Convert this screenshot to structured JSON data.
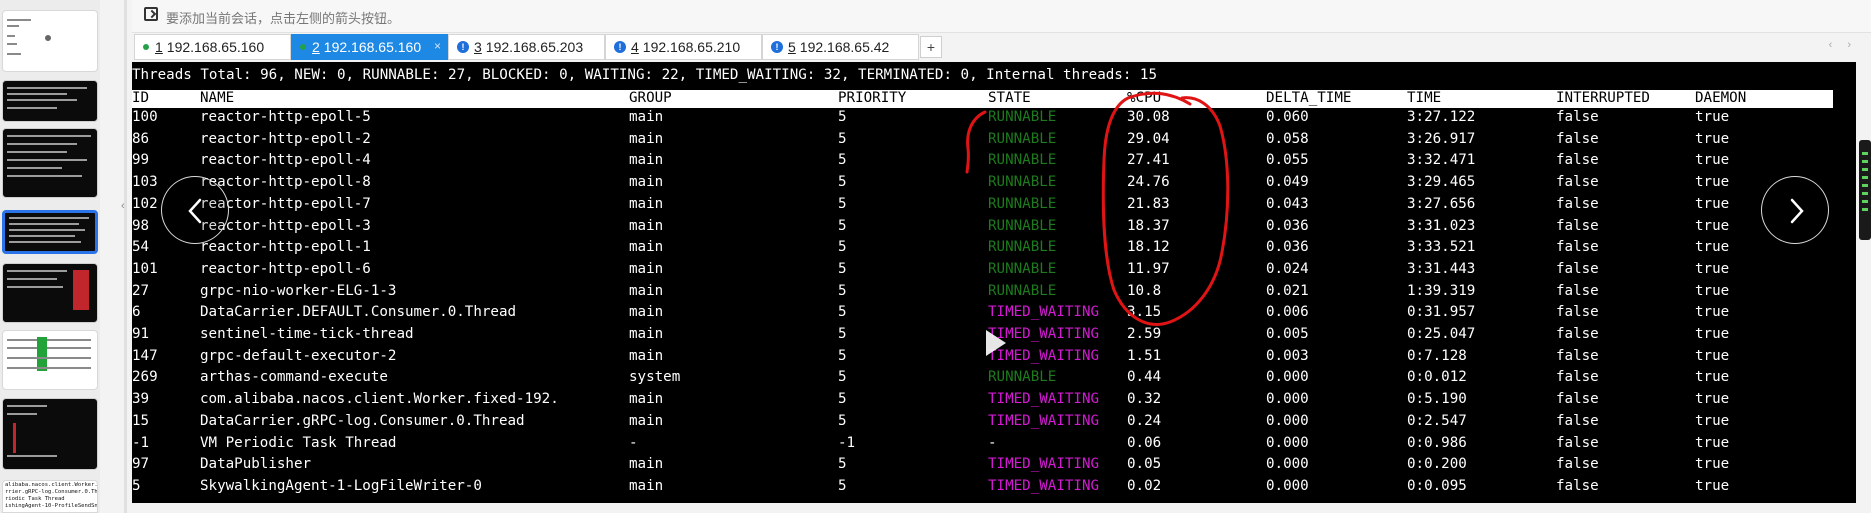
{
  "hint": {
    "text": "要添加当前会话，点击左侧的箭头按钮。"
  },
  "tabs": [
    {
      "num": "1",
      "label": "192.168.65.160",
      "status": "connected",
      "active": false
    },
    {
      "num": "2",
      "label": "192.168.65.160",
      "status": "connected",
      "active": true
    },
    {
      "num": "3",
      "label": "192.168.65.203",
      "status": "info",
      "active": false
    },
    {
      "num": "4",
      "label": "192.168.65.210",
      "status": "info",
      "active": false
    },
    {
      "num": "5",
      "label": "192.168.65.42",
      "status": "info",
      "active": false
    }
  ],
  "tab_close": "×",
  "tab_add": "+",
  "terminal": {
    "summary": "Threads Total: 96, NEW: 0, RUNNABLE: 27, BLOCKED: 0, WAITING: 22, TIMED_WAITING: 32, TERMINATED: 0, Internal threads: 15",
    "columns": [
      "ID",
      "NAME",
      "GROUP",
      "PRIORITY",
      "STATE",
      "%CPU",
      "DELTA_TIME",
      "TIME",
      "INTERRUPTED",
      "DAEMON"
    ],
    "rows": [
      {
        "id": "100",
        "name": "reactor-http-epoll-5",
        "group": "main",
        "priority": "5",
        "state": "RUNNABLE",
        "cpu": "30.08",
        "delta": "0.060",
        "time": "3:27.122",
        "interrupted": "false",
        "daemon": "true"
      },
      {
        "id": "86",
        "name": "reactor-http-epoll-2",
        "group": "main",
        "priority": "5",
        "state": "RUNNABLE",
        "cpu": "29.04",
        "delta": "0.058",
        "time": "3:26.917",
        "interrupted": "false",
        "daemon": "true"
      },
      {
        "id": "99",
        "name": "reactor-http-epoll-4",
        "group": "main",
        "priority": "5",
        "state": "RUNNABLE",
        "cpu": "27.41",
        "delta": "0.055",
        "time": "3:32.471",
        "interrupted": "false",
        "daemon": "true"
      },
      {
        "id": "103",
        "name": "reactor-http-epoll-8",
        "group": "main",
        "priority": "5",
        "state": "RUNNABLE",
        "cpu": "24.76",
        "delta": "0.049",
        "time": "3:29.465",
        "interrupted": "false",
        "daemon": "true"
      },
      {
        "id": "102",
        "name": "reactor-http-epoll-7",
        "group": "main",
        "priority": "5",
        "state": "RUNNABLE",
        "cpu": "21.83",
        "delta": "0.043",
        "time": "3:27.656",
        "interrupted": "false",
        "daemon": "true"
      },
      {
        "id": "98",
        "name": "reactor-http-epoll-3",
        "group": "main",
        "priority": "5",
        "state": "RUNNABLE",
        "cpu": "18.37",
        "delta": "0.036",
        "time": "3:31.023",
        "interrupted": "false",
        "daemon": "true"
      },
      {
        "id": "54",
        "name": "reactor-http-epoll-1",
        "group": "main",
        "priority": "5",
        "state": "RUNNABLE",
        "cpu": "18.12",
        "delta": "0.036",
        "time": "3:33.521",
        "interrupted": "false",
        "daemon": "true"
      },
      {
        "id": "101",
        "name": "reactor-http-epoll-6",
        "group": "main",
        "priority": "5",
        "state": "RUNNABLE",
        "cpu": "11.97",
        "delta": "0.024",
        "time": "3:31.443",
        "interrupted": "false",
        "daemon": "true"
      },
      {
        "id": "27",
        "name": "grpc-nio-worker-ELG-1-3",
        "group": "main",
        "priority": "5",
        "state": "RUNNABLE",
        "cpu": "10.8",
        "delta": "0.021",
        "time": "1:39.319",
        "interrupted": "false",
        "daemon": "true"
      },
      {
        "id": "6",
        "name": "DataCarrier.DEFAULT.Consumer.0.Thread",
        "group": "main",
        "priority": "5",
        "state": "TIMED_WAITING",
        "cpu": "3.15",
        "delta": "0.006",
        "time": "0:31.957",
        "interrupted": "false",
        "daemon": "true"
      },
      {
        "id": "91",
        "name": "sentinel-time-tick-thread",
        "group": "main",
        "priority": "5",
        "state": "TIMED_WAITING",
        "cpu": "2.59",
        "delta": "0.005",
        "time": "0:25.047",
        "interrupted": "false",
        "daemon": "true"
      },
      {
        "id": "147",
        "name": "grpc-default-executor-2",
        "group": "main",
        "priority": "5",
        "state": "TIMED_WAITING",
        "cpu": "1.51",
        "delta": "0.003",
        "time": "0:7.128",
        "interrupted": "false",
        "daemon": "true"
      },
      {
        "id": "269",
        "name": "arthas-command-execute",
        "group": "system",
        "priority": "5",
        "state": "RUNNABLE",
        "cpu": "0.44",
        "delta": "0.000",
        "time": "0:0.012",
        "interrupted": "false",
        "daemon": "true"
      },
      {
        "id": "39",
        "name": "com.alibaba.nacos.client.Worker.fixed-192.",
        "group": "main",
        "priority": "5",
        "state": "TIMED_WAITING",
        "cpu": "0.32",
        "delta": "0.000",
        "time": "0:5.190",
        "interrupted": "false",
        "daemon": "true"
      },
      {
        "id": "15",
        "name": "DataCarrier.gRPC-log.Consumer.0.Thread",
        "group": "main",
        "priority": "5",
        "state": "TIMED_WAITING",
        "cpu": "0.24",
        "delta": "0.000",
        "time": "0:2.547",
        "interrupted": "false",
        "daemon": "true"
      },
      {
        "id": "-1",
        "name": "VM Periodic Task Thread",
        "group": "-",
        "priority": "-1",
        "state": "-",
        "cpu": "0.06",
        "delta": "0.000",
        "time": "0:0.986",
        "interrupted": "false",
        "daemon": "true"
      },
      {
        "id": "97",
        "name": "DataPublisher",
        "group": "main",
        "priority": "5",
        "state": "TIMED_WAITING",
        "cpu": "0.05",
        "delta": "0.000",
        "time": "0:0.200",
        "interrupted": "false",
        "daemon": "true"
      },
      {
        "id": "5",
        "name": "SkywalkingAgent-1-LogFileWriter-0",
        "group": "main",
        "priority": "5",
        "state": "TIMED_WAITING",
        "cpu": "0.02",
        "delta": "0.000",
        "time": "0:0.095",
        "interrupted": "false",
        "daemon": "true"
      }
    ]
  },
  "thumb_text": "alibaba.nacos.client.Worker.fixed-\nrrier.gRPC-log.Consumer.0.Thread\nriodic Task Thread\nishingAgent-10-ProfileSendSnapshot",
  "colors": {
    "runnable": "#1d7a1d",
    "timed_waiting": "#d41ad4",
    "active_tab": "#1e88e5",
    "annotation": "#e01414",
    "terminal_bg": "#000000"
  },
  "icons": [
    "plus-box-icon",
    "connected-dot-icon",
    "info-icon",
    "close-icon",
    "chevron-left-icon",
    "chevron-right-icon",
    "play-icon"
  ]
}
